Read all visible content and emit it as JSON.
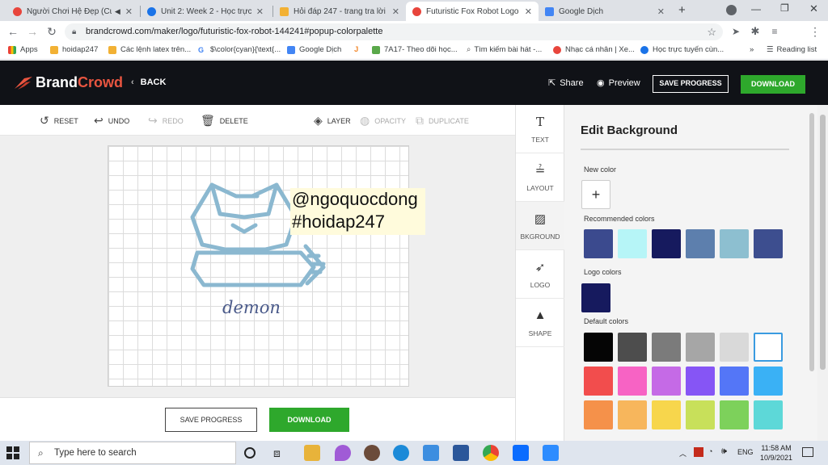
{
  "browser": {
    "tabs": [
      {
        "title": "Người Chơi Hệ Đẹp (Cuc",
        "active": false,
        "icon": "music-favicon"
      },
      {
        "title": "Unit 2: Week 2 - Học trực tuy",
        "active": false,
        "icon": "cloud-favicon"
      },
      {
        "title": "Hỏi đáp 247 - trang tra lời",
        "active": false,
        "icon": "h-favicon"
      },
      {
        "title": "Futuristic Fox Robot Logo | B",
        "active": true,
        "icon": "brandcrowd-favicon"
      },
      {
        "title": "Google Dịch",
        "active": false,
        "icon": "translate-favicon"
      }
    ],
    "url": "brandcrowd.com/maker/logo/futuristic-fox-robot-144241#popup-colorpalette",
    "bookmarks": [
      {
        "label": "Apps"
      },
      {
        "label": "hoidap247"
      },
      {
        "label": "Các lệnh latex trên..."
      },
      {
        "label": "$\\color{cyan}{\\text{..."
      },
      {
        "label": "Google Dịch"
      },
      {
        "label": ""
      },
      {
        "label": "7A17- Theo dõi học..."
      },
      {
        "label": "Tìm kiếm bài hát -..."
      },
      {
        "label": "Nhạc cá nhân | Xe..."
      },
      {
        "label": "Học trực tuyến cùn..."
      }
    ],
    "bookmarks_more": "»",
    "reading_list": "Reading list"
  },
  "header": {
    "brand_part1": "Brand",
    "brand_part2": "Crowd",
    "back": "BACK",
    "share": "Share",
    "preview": "Preview",
    "save_progress": "SAVE PROGRESS",
    "download": "DOWNLOAD"
  },
  "toolbar": {
    "reset": "RESET",
    "undo": "UNDO",
    "redo": "REDO",
    "delete": "DELETE",
    "layer": "LAYER",
    "opacity": "OPACITY",
    "duplicate": "DUPLICATE"
  },
  "canvas": {
    "overlay_line1": "@ngoquocdong",
    "overlay_line2": "#hoidap247",
    "logo_word": "demon",
    "logo_color": "#8bb8d0"
  },
  "canvas_actions": {
    "save_progress": "SAVE PROGRESS",
    "download": "DOWNLOAD"
  },
  "sidetools": [
    {
      "label": "TEXT",
      "icon": "text-icon"
    },
    {
      "label": "LAYOUT",
      "icon": "layout-icon"
    },
    {
      "label": "BKGROUND",
      "icon": "background-icon"
    },
    {
      "label": "LOGO",
      "icon": "logo-icon"
    },
    {
      "label": "SHAPE",
      "icon": "shape-icon"
    }
  ],
  "panel": {
    "title": "Edit Background",
    "new_color": "New color",
    "recommended": "Recommended colors",
    "recommended_colors": [
      "#3b4a8e",
      "#b6f5f7",
      "#161a5e",
      "#5d7fad",
      "#8dbfd0",
      "#3d4e8f"
    ],
    "logo_colors_label": "Logo colors",
    "logo_colors": [
      "#161a5e"
    ],
    "default_label": "Default colors",
    "default_colors": [
      "#050505",
      "#4d4d4d",
      "#7b7b7b",
      "#a6a6a6",
      "#d9d9d9",
      "#ffffff",
      "#f24d4d",
      "#f763c4",
      "#c56ae6",
      "#8655f5",
      "#5476f7",
      "#3ab1f5",
      "#f5914a",
      "#f7b65c",
      "#f7d64c",
      "#c8e05a",
      "#7dd15b",
      "#5dd8d8"
    ],
    "selected_default": 5
  },
  "taskbar": {
    "search_placeholder": "Type here to search",
    "language": "ENG",
    "time": "11:58 AM",
    "date": "10/9/2021"
  }
}
